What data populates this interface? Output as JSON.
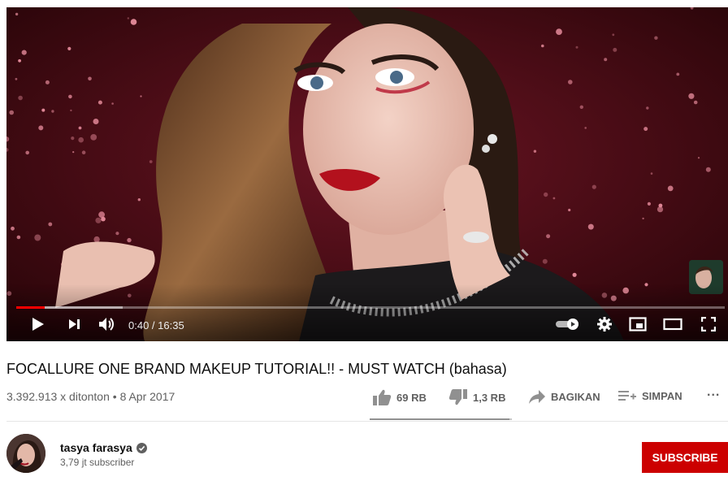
{
  "player": {
    "current_time": "0:40",
    "duration": "16:35",
    "time_display": "0:40 / 16:35",
    "played_fraction": 0.04,
    "buffered_fraction": 0.15,
    "icons": [
      "play-icon",
      "next-icon",
      "volume-icon",
      "autoplay-toggle-icon",
      "settings-icon",
      "miniplayer-icon",
      "theater-icon",
      "fullscreen-icon"
    ],
    "colors": {
      "progress": "#ff0000"
    }
  },
  "video": {
    "title": "FOCALLURE ONE BRAND MAKEUP TUTORIAL!! - MUST WATCH (bahasa)",
    "views_date": "3.392.913 x ditonton • 8 Apr 2017",
    "likes": "69 RB",
    "dislikes": "1,3 RB",
    "like_fraction": 0.98
  },
  "actions": {
    "share": "BAGIKAN",
    "save": "SIMPAN",
    "more": "..."
  },
  "channel": {
    "name": "tasya farasya",
    "subscribers": "3,79 jt subscriber",
    "verified": true
  },
  "subscribe": {
    "label": "SUBSCRIBE",
    "color": "#cc0000"
  }
}
